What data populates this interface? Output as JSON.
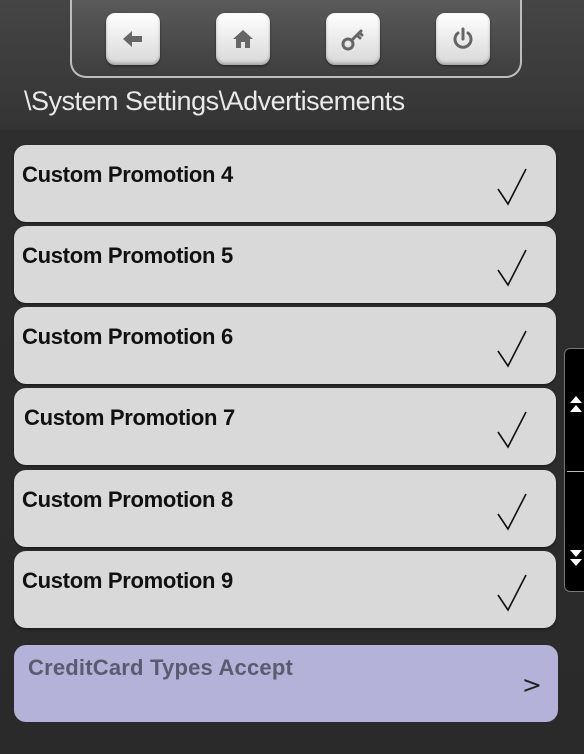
{
  "nav": {
    "buttons": [
      {
        "icon": "back-arrow-icon"
      },
      {
        "icon": "home-icon"
      },
      {
        "icon": "key-icon"
      },
      {
        "icon": "power-icon"
      }
    ]
  },
  "breadcrumb": "\\System Settings\\Advertisements",
  "promotions": [
    {
      "label": "Custom Promotion 4",
      "check": "√"
    },
    {
      "label": "Custom Promotion 5",
      "check": "√"
    },
    {
      "label": "Custom Promotion 6",
      "check": "√"
    },
    {
      "label": "Custom Promotion 7",
      "check": "√"
    },
    {
      "label": "Custom Promotion 8",
      "check": "√"
    },
    {
      "label": "Custom Promotion 9",
      "check": "√"
    }
  ],
  "credit_card": {
    "label": "CreditCard Types Accept",
    "chevron": ">"
  },
  "colors": {
    "row_bg": "#d9d9d9",
    "credit_bg": "#b4b2d8",
    "background": "#2e2e2e"
  }
}
